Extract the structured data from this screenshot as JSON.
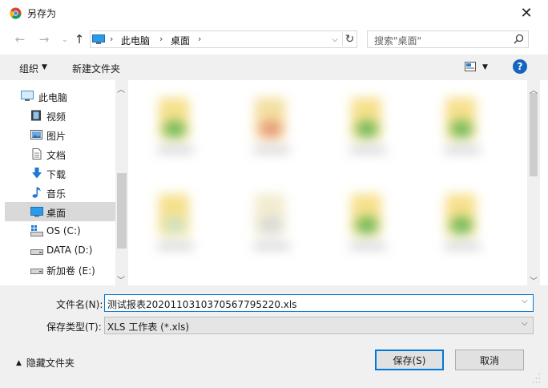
{
  "window": {
    "title": "另存为",
    "close_glyph": "✕"
  },
  "nav": {
    "back": "←",
    "forward": "→",
    "up": "↑",
    "breadcrumb": [
      "此电脑",
      "桌面"
    ],
    "separator": "›",
    "refresh": "↻"
  },
  "search": {
    "placeholder": "搜索\"桌面\""
  },
  "toolbar": {
    "organize_label": "组织",
    "new_folder_label": "新建文件夹",
    "help_label": "?"
  },
  "sidebar": {
    "items": [
      {
        "label": "此电脑",
        "icon": "computer-icon"
      },
      {
        "label": "视频",
        "icon": "video-icon"
      },
      {
        "label": "图片",
        "icon": "picture-icon"
      },
      {
        "label": "文档",
        "icon": "document-icon"
      },
      {
        "label": "下载",
        "icon": "download-icon"
      },
      {
        "label": "音乐",
        "icon": "music-icon"
      },
      {
        "label": "桌面",
        "icon": "desktop-icon",
        "selected": true
      },
      {
        "label": "OS (C:)",
        "icon": "os-drive-icon"
      },
      {
        "label": "DATA (D:)",
        "icon": "drive-icon"
      },
      {
        "label": "新加卷 (E:)",
        "icon": "drive-icon"
      }
    ]
  },
  "form": {
    "filename_label": "文件名(N):",
    "filename_value": "测试报表20201103103705677952​20.xls",
    "filetype_label": "保存类型(T):",
    "filetype_value": "XLS 工作表 (*.xls)"
  },
  "footer": {
    "hide_folders_label": "隐藏文件夹",
    "save_label": "保存(S)",
    "cancel_label": "取消"
  },
  "colors": {
    "accent": "#0078d7",
    "help_bg": "#1565c0",
    "selected_row": "#d9d9d9",
    "toolbar_bg": "#f0f0f0"
  }
}
